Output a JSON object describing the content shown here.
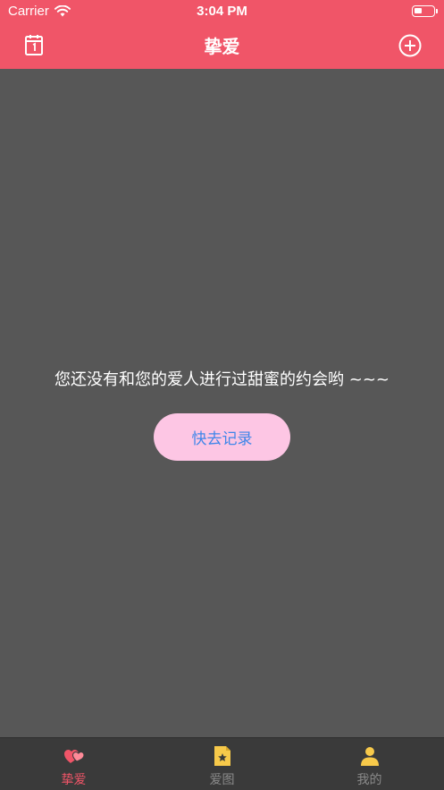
{
  "status_bar": {
    "carrier": "Carrier",
    "time": "3:04 PM"
  },
  "header": {
    "title": "挚爱"
  },
  "empty_state": {
    "message": "您还没有和您的爱人进行过甜蜜的约会哟 ~~~",
    "button_label": "快去记录"
  },
  "tabbar": {
    "items": [
      {
        "label": "挚爱",
        "icon": "hearts-icon",
        "active": true
      },
      {
        "label": "爱图",
        "icon": "photo-star-icon",
        "active": false
      },
      {
        "label": "我的",
        "icon": "person-icon",
        "active": false
      }
    ]
  },
  "colors": {
    "accent": "#f05568",
    "background": "#575757",
    "button_bg": "#fdc6e4",
    "button_text": "#3f86e9",
    "tab_icon_yellow": "#f7c94a"
  }
}
